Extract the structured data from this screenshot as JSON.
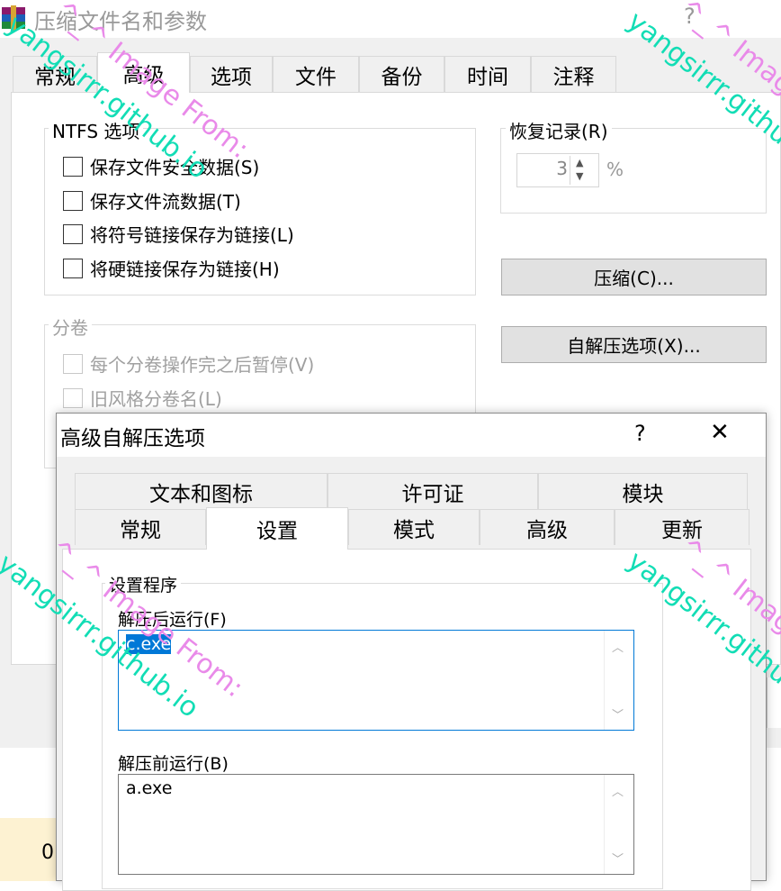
{
  "bg": {
    "title": "压缩文件名和参数",
    "help": "?",
    "tabs": [
      "常规",
      "高级",
      "选项",
      "文件",
      "备份",
      "时间",
      "注释"
    ],
    "ntfs": {
      "title": "NTFS 选项",
      "items": [
        "保存文件安全数据(S)",
        "保存文件流数据(T)",
        "将符号链接保存为链接(L)",
        "将硬链接保存为链接(H)"
      ]
    },
    "volume": {
      "title": "分卷",
      "items": [
        "每个分卷操作完之后暂停(V)",
        "旧风格分卷名(L)"
      ]
    },
    "recovery": {
      "title": "恢复记录(R)",
      "value": "3",
      "unit": "%"
    },
    "compress_button": "压缩(C)...",
    "sfx_button": "自解压选项(X)...",
    "bottom_value": "0"
  },
  "dialog": {
    "title": "高级自解压选项",
    "help": "?",
    "close": "✕",
    "tabs_top": [
      "文本和图标",
      "许可证",
      "模块"
    ],
    "tabs_bottom": [
      "常规",
      "设置",
      "模式",
      "高级",
      "更新"
    ],
    "setup_group": "设置程序",
    "run_after_label": "解压后运行(F)",
    "run_after_value": "c.exe",
    "run_before_label": "解压前运行(B)",
    "run_before_value": "a.exe"
  },
  "watermark": {
    "line1": "yangsirrr.github.io",
    "line2": "^_^ Image From:"
  }
}
